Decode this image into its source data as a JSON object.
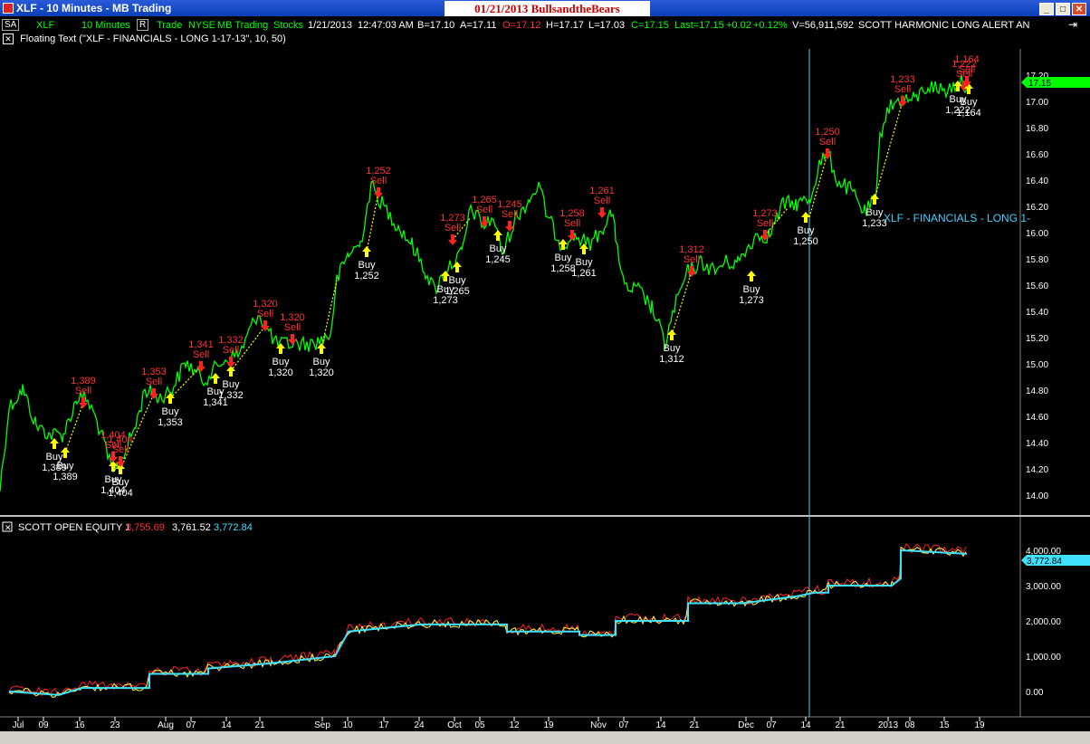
{
  "window": {
    "title": "XLF - 10 Minutes - MB Trading",
    "banner": "01/21/2013  BullsandtheBears"
  },
  "toolbar": {
    "symbol_box": "SA",
    "symbol": "XLF",
    "interval": "10 Minutes",
    "r_box": "R",
    "data_type": "Trade",
    "exchange": "NYSE",
    "feed": "MB Trading",
    "category": "Stocks",
    "date": "1/21/2013",
    "time": "12:47:03 AM",
    "bid": "B=17.10",
    "ask": "A=17.11",
    "open": "O=17.12",
    "high": "H=17.17",
    "low": "L=17.03",
    "close": "C=17.15",
    "last": "Last=17.15",
    "change": "+0.02",
    "change_pct": "+0.12%",
    "volume": "V=56,911,592",
    "alert": "SCOTT HARMONIC LONG ALERT AN"
  },
  "indicator1": "Floating Text  (\"XLF - FINANCIALS - LONG 1-17-13\",  10,  50)",
  "price_panel": {
    "floating_label": "XLF - FINANCIALS - LONG 1-",
    "last_badge": "17.15",
    "y_ticks": [
      "17.20",
      "17.00",
      "16.80",
      "16.60",
      "16.40",
      "16.20",
      "16.00",
      "15.80",
      "15.60",
      "15.40",
      "15.20",
      "15.00",
      "14.80",
      "14.60",
      "14.40",
      "14.20",
      "14.00"
    ]
  },
  "equity_panel": {
    "name": "SCOTT OPEN EQUITY 1",
    "v1": "3,755.69",
    "v2": "3,761.52",
    "v3": "3,772.84",
    "badge": "3,772.84",
    "y_ticks": [
      "4,000.00",
      "3,000.00",
      "2,000.00",
      "1,000.00",
      "0.00"
    ]
  },
  "x_axis": [
    "Jul",
    "09",
    "16",
    "23",
    "Aug",
    "07",
    "14",
    "21",
    "Sep",
    "10",
    "17",
    "24",
    "Oct",
    "05",
    "12",
    "19",
    "Nov",
    "07",
    "14",
    "21",
    "Dec",
    "07",
    "14",
    "21",
    "2013",
    "08",
    "15",
    "19"
  ],
  "trades": [
    {
      "type": "buy",
      "num": "1,389"
    },
    {
      "type": "buy",
      "num": "1,389"
    },
    {
      "type": "sell",
      "num": "1,389"
    },
    {
      "type": "buy",
      "num": "1,404"
    },
    {
      "type": "buy",
      "num": "1,404"
    },
    {
      "type": "sell",
      "num": "1,404"
    },
    {
      "type": "sell",
      "num": "1,404"
    },
    {
      "type": "buy",
      "num": "1,353"
    },
    {
      "type": "sell",
      "num": "1,353"
    },
    {
      "type": "buy",
      "num": "1,341"
    },
    {
      "type": "sell",
      "num": "1,341"
    },
    {
      "type": "buy",
      "num": "1,332"
    },
    {
      "type": "sell",
      "num": "1,332"
    },
    {
      "type": "buy",
      "num": "1,320"
    },
    {
      "type": "sell",
      "num": "1,320"
    },
    {
      "type": "buy",
      "num": "1,320"
    },
    {
      "type": "sell",
      "num": "1,320"
    },
    {
      "type": "buy",
      "num": "1,252"
    },
    {
      "type": "sell",
      "num": "1,252"
    },
    {
      "type": "buy",
      "num": "1,273"
    },
    {
      "type": "sell",
      "num": "1,273"
    },
    {
      "type": "buy",
      "num": "1,265"
    },
    {
      "type": "sell",
      "num": "1,265"
    },
    {
      "type": "buy",
      "num": "1,245"
    },
    {
      "type": "sell",
      "num": "1,245"
    },
    {
      "type": "buy",
      "num": "1,258"
    },
    {
      "type": "sell",
      "num": "1,258"
    },
    {
      "type": "buy",
      "num": "1,261"
    },
    {
      "type": "sell",
      "num": "1,261"
    },
    {
      "type": "buy",
      "num": "1,312"
    },
    {
      "type": "sell",
      "num": "1,312"
    },
    {
      "type": "buy",
      "num": "1,273"
    },
    {
      "type": "sell",
      "num": "1,273"
    },
    {
      "type": "buy",
      "num": "1,250"
    },
    {
      "type": "sell",
      "num": "1,250"
    },
    {
      "type": "buy",
      "num": "1,233"
    },
    {
      "type": "sell",
      "num": "1,233"
    },
    {
      "type": "buy",
      "num": "1,222"
    },
    {
      "type": "sell",
      "num": "1,222"
    },
    {
      "type": "buy",
      "num": "1,164"
    },
    {
      "type": "sell",
      "num": "1,164"
    }
  ],
  "labels": {
    "buy": "Buy",
    "sell": "Sell"
  },
  "colors": {
    "price": "#00ff00",
    "equity_cyan": "#40e0ff",
    "equity_red": "#ff2020",
    "equity_yellow": "#ffff40",
    "buy": "#ffff00",
    "sell": "#ff2020"
  }
}
